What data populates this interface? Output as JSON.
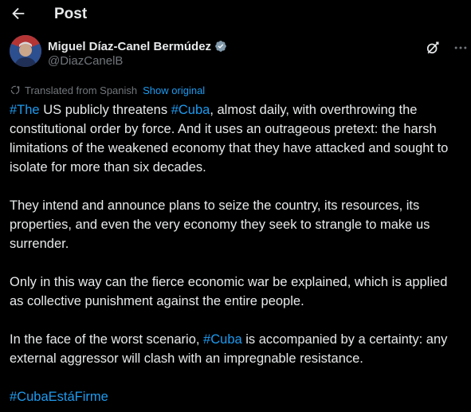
{
  "header": {
    "title": "Post",
    "back_icon": "arrow-left-icon"
  },
  "author": {
    "display_name": "Miguel Díaz-Canel Bermúdez",
    "handle": "@DiazCanelB",
    "verified_icon": "verified-badge-icon",
    "verified_color": "#1d9bf0"
  },
  "translation": {
    "label": "Translated from Spanish",
    "show_original": "Show original"
  },
  "tweet": {
    "p1": {
      "tag1": "#The",
      "t1": " US publicly threatens ",
      "tag2": "#Cuba",
      "t2": ", almost daily, with overthrowing the constitutional order by force. And it uses an outrageous pretext: the harsh limitations of the weakened economy that they have attacked and sought to isolate for more than six decades."
    },
    "p2": "They intend and announce plans to seize the country, its resources, its properties, and even the very economy they seek to strangle to make us surrender.",
    "p3": "Only in this way can the fierce economic war be explained, which is applied as collective punishment against the entire people.",
    "p4": {
      "t1": "In the face of the worst scenario, ",
      "tag": "#Cuba",
      "t2": " is accompanied by a certainty: any external aggressor will clash with an impregnable resistance."
    },
    "p5_tag": "#CubaEstáFirme"
  },
  "colors": {
    "background": "#000000",
    "text": "#e7e9ea",
    "secondary_text": "#71767b",
    "accent": "#1d9bf0"
  }
}
